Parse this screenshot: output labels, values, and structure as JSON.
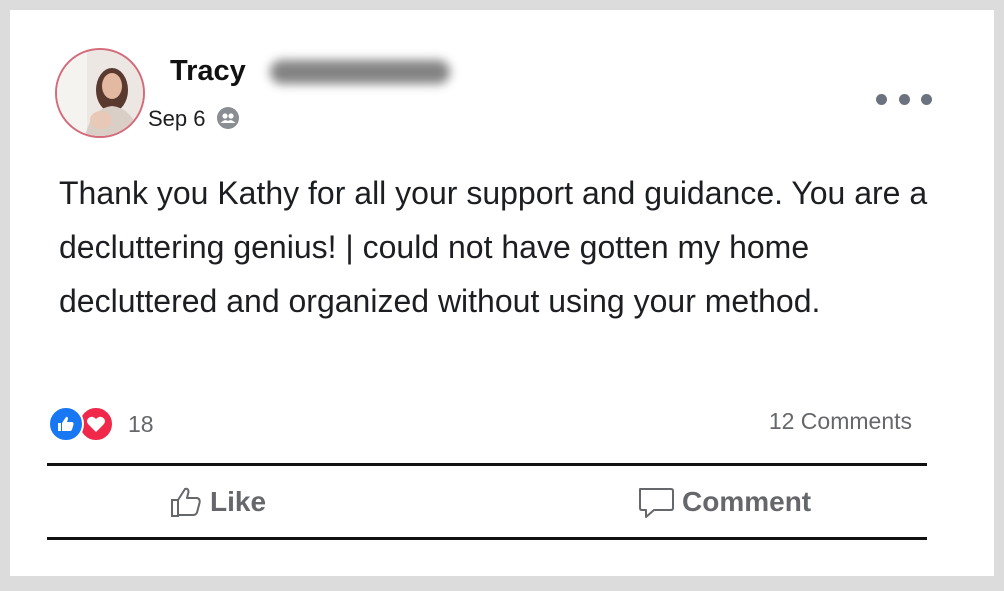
{
  "post": {
    "author_name": "Tracy",
    "date": "Sep 6",
    "text": "Thank you Kathy for all your support and guidance. You are a decluttering genius! | could not have gotten my home decluttered and organized without using your method.",
    "privacy_icon": "friends-icon",
    "more_icon": "more-dots-icon"
  },
  "reactions": {
    "types": [
      "like-icon",
      "love-icon"
    ],
    "count": "18"
  },
  "comments": {
    "count_label": "12 Comments"
  },
  "actions": {
    "like_label": "Like",
    "comment_label": "Comment"
  },
  "colors": {
    "like_blue": "#1877f2",
    "love_red": "#f02849",
    "secondary_text": "#65676b",
    "avatar_ring": "#d46b7a"
  }
}
